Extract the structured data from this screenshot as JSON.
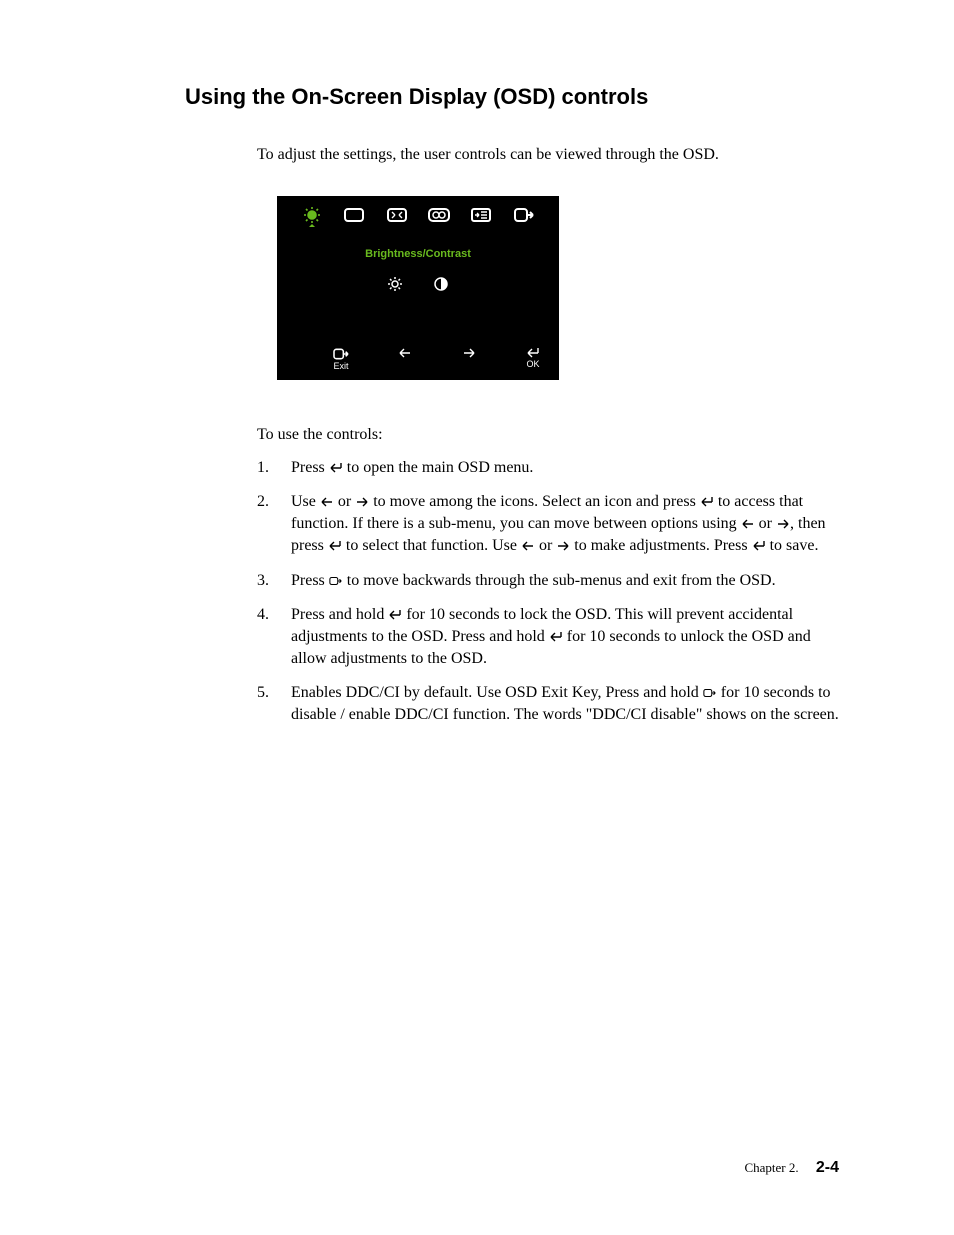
{
  "heading": "Using the On-Screen Display (OSD) controls",
  "intro": "To adjust the settings,  the user controls can be viewed through the OSD.",
  "osd": {
    "title": "Brightness/Contrast",
    "top_icons": [
      "brightness-icon",
      "screen-icon",
      "image-pos-icon",
      "color-icon",
      "menu-icon",
      "exit-icon"
    ],
    "sub_icons": [
      "brightness-small-icon",
      "contrast-icon"
    ],
    "bottom": {
      "exit_label": "Exit",
      "ok_label": "OK"
    }
  },
  "intro2": "To use the controls:",
  "steps": [
    {
      "parts": [
        {
          "t": "Press "
        },
        {
          "icon": "enter-icon"
        },
        {
          "t": " to open the main OSD menu."
        }
      ]
    },
    {
      "parts": [
        {
          "t": "Use "
        },
        {
          "icon": "left-arrow-icon"
        },
        {
          "t": " or "
        },
        {
          "icon": "right-arrow-icon"
        },
        {
          "t": " to move among the icons. Select an icon and press  "
        },
        {
          "icon": "enter-icon"
        },
        {
          "t": " to access that function. If there is a sub-menu, you can move between options using  "
        },
        {
          "icon": "left-arrow-icon"
        },
        {
          "t": " or "
        },
        {
          "icon": "right-arrow-icon"
        },
        {
          "t": ", then press  "
        },
        {
          "icon": "enter-icon"
        },
        {
          "t": " to select that function. Use "
        },
        {
          "icon": "left-arrow-icon"
        },
        {
          "t": " or "
        },
        {
          "icon": "right-arrow-icon"
        },
        {
          "t": " to make adjustments. Press "
        },
        {
          "icon": "enter-icon"
        },
        {
          "t": " to save."
        }
      ]
    },
    {
      "parts": [
        {
          "t": "Press "
        },
        {
          "icon": "back-icon"
        },
        {
          "t": " to move backwards through the sub-menus and exit from the OSD."
        }
      ]
    },
    {
      "parts": [
        {
          "t": "Press and hold  "
        },
        {
          "icon": "enter-icon"
        },
        {
          "t": "  for 10 seconds to lock the OSD. This will prevent accidental adjustments to the OSD. Press and hold "
        },
        {
          "icon": "enter-icon"
        },
        {
          "t": "  for 10 seconds to unlock the OSD and allow adjustments to the OSD."
        }
      ]
    },
    {
      "parts": [
        {
          "t": "Enables DDC/CI by default. Use OSD Exit Key,  Press and hold "
        },
        {
          "icon": "back-icon"
        },
        {
          "t": " for 10 seconds to disable / enable DDC/CI function. The words \"DDC/CI disable\" shows on the screen."
        }
      ]
    }
  ],
  "footer": {
    "chapter": "Chapter 2.",
    "page": "2-4"
  }
}
